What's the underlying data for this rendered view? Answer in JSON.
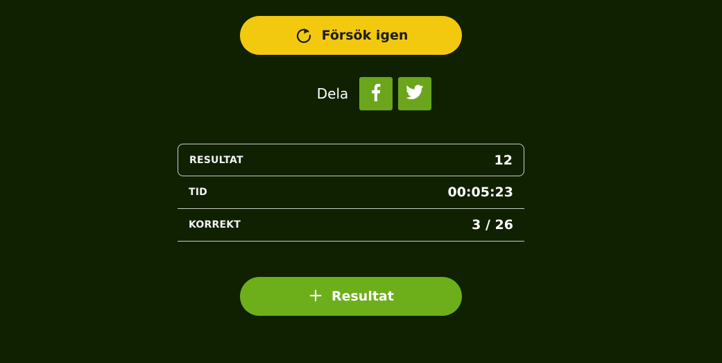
{
  "retry_button": {
    "label": "Försök igen",
    "icon": "refresh-icon",
    "color": "#f2c90f"
  },
  "share": {
    "label": "Dela",
    "buttons": [
      {
        "icon": "facebook-icon",
        "label": "f"
      },
      {
        "icon": "twitter-icon"
      }
    ],
    "color": "#6aa51c"
  },
  "stats": [
    {
      "label": "RESULTAT",
      "value": "12"
    },
    {
      "label": "TID",
      "value": "00:05:23"
    },
    {
      "label": "KORREKT",
      "value": "3 / 26"
    }
  ],
  "add_button": {
    "label": "Resultat",
    "icon": "plus-icon",
    "icon_glyph": "+",
    "color": "#6daf1a"
  },
  "background_color": "#102101"
}
